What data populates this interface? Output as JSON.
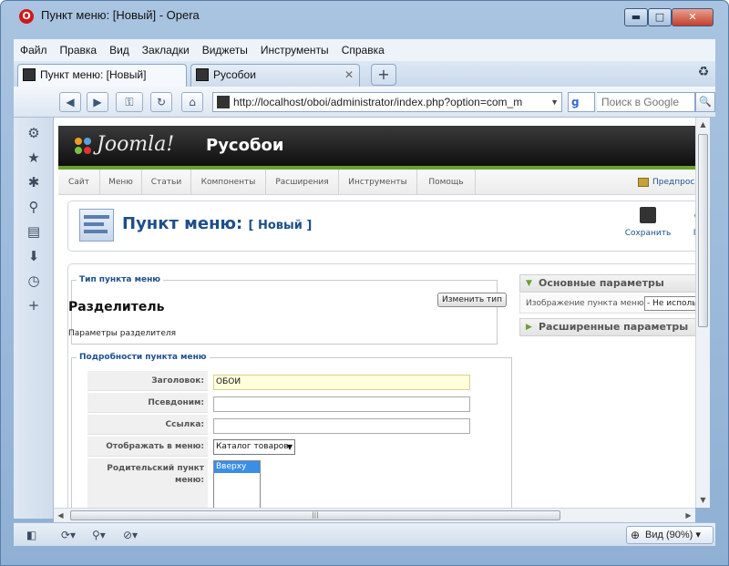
{
  "window": {
    "title": "Пункт меню: [Новый] - Opera",
    "logo_glyph": "O",
    "controls": {
      "minimize": "▬",
      "maximize": "□",
      "close": "✕"
    }
  },
  "menubar": [
    "Файл",
    "Правка",
    "Вид",
    "Закладки",
    "Виджеты",
    "Инструменты",
    "Справка"
  ],
  "tabs": [
    {
      "label": "Пункт меню: [Новый]",
      "active": true,
      "close": "✕"
    },
    {
      "label": "Русобои",
      "active": false,
      "close": "✕"
    }
  ],
  "tabbar": {
    "new_tab": "+",
    "trash_icon": "trash-icon"
  },
  "navbar": {
    "back": "◀",
    "forward": "▶",
    "key": "⚿",
    "reload": "↻",
    "home": "⌂",
    "address": "http://localhost/oboi/administrator/index.php?option=com_m",
    "address_dropdown": "▼",
    "search_engine": "g",
    "search_placeholder": "Поиск в Google",
    "search_go": "🔍"
  },
  "panel_icons": [
    "speed-dial-icon",
    "bookmarks-icon",
    "widgets-icon",
    "links-icon",
    "notes-icon",
    "downloads-icon",
    "history-icon",
    "add-panel-icon"
  ],
  "panel_glyphs": [
    "⚙",
    "★",
    "✱",
    "⚲",
    "▤",
    "⬇",
    "◷",
    "+"
  ],
  "statusbar": {
    "glyphs": [
      "◧",
      "⟳▾",
      "⚲▾",
      "⊘▾"
    ],
    "zoom_label": "Вид (90%)",
    "zoom_icon": "⊕",
    "zoom_dropdown": "▾"
  },
  "scrollbar": {
    "up": "▲",
    "down": "▼",
    "left": "◀",
    "right": "▶",
    "grip": "|||"
  },
  "joomla": {
    "logo_text": "Joomla!",
    "site_name": "Русобои",
    "menu": [
      "Сайт",
      "Меню",
      "Статьи",
      "Компоненты",
      "Расширения",
      "Инструменты",
      "Помощь"
    ],
    "preview": "Предпросм",
    "page_title": "Пункт меню:",
    "page_subtitle": "[ Новый ]",
    "toolbar": {
      "save": "Сохранить",
      "apply": "Пр",
      "apply_glyph": "✔"
    },
    "type_section": {
      "legend": "Тип пункта меню",
      "name": "Разделитель",
      "params": "Параметры разделителя",
      "change_button": "Изменить тип"
    },
    "details_section": {
      "legend": "Подробности пункта меню",
      "fields": [
        {
          "label": "Заголовок:",
          "value": "ОБОИ"
        },
        {
          "label": "Псевдоним:",
          "value": ""
        },
        {
          "label": "Ссылка:",
          "value": ""
        },
        {
          "label": "Отображать в меню:",
          "value": "Каталог товаров",
          "dropdown": "▼"
        }
      ],
      "parent_label": "Родительский пункт меню:",
      "parent_option": "Вверху"
    },
    "side_panel": {
      "basic_params": "Основные параметры",
      "arrow_open": "▼",
      "arrow_closed": "▶",
      "image_label": "Изображение пункта меню",
      "image_value": "- Не использова",
      "advanced_params": "Расширенные параметры"
    }
  }
}
